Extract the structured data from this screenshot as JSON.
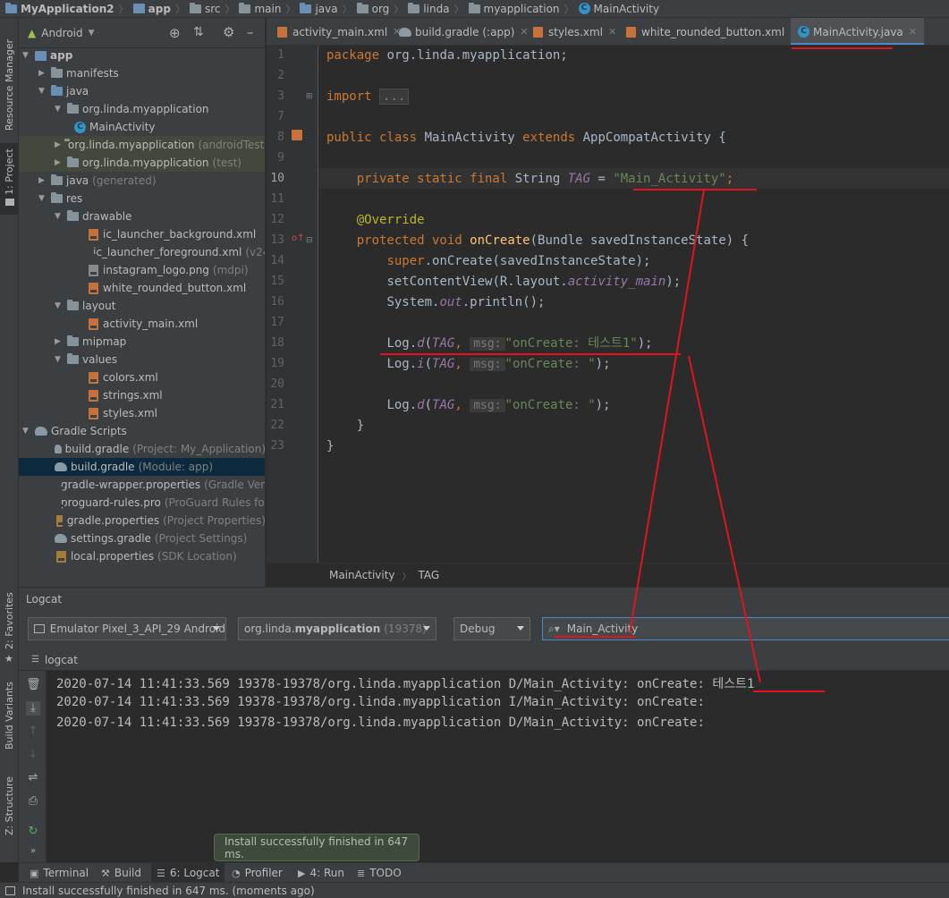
{
  "breadcrumb": [
    "MyApplication2",
    "app",
    "src",
    "main",
    "java",
    "org",
    "linda",
    "myapplication",
    "MainActivity"
  ],
  "left_strip": {
    "resource_manager": "Resource Manager",
    "project": "1: Project",
    "favorites": "2: Favorites",
    "build_variants": "Build Variants",
    "structure": "Z: Structure"
  },
  "project": {
    "view_selector": "Android",
    "tree": [
      {
        "label": "app",
        "hint": "",
        "type": "module"
      },
      {
        "label": "manifests",
        "hint": "",
        "type": "folder"
      },
      {
        "label": "java",
        "hint": "",
        "type": "folder"
      },
      {
        "label": "org.linda.myapplication",
        "hint": "",
        "type": "package"
      },
      {
        "label": "MainActivity",
        "hint": "",
        "type": "class"
      },
      {
        "label": "org.linda.myapplication",
        "hint": "(androidTest)",
        "type": "package"
      },
      {
        "label": "org.linda.myapplication",
        "hint": "(test)",
        "type": "package"
      },
      {
        "label": "java",
        "hint": "(generated)",
        "type": "folder"
      },
      {
        "label": "res",
        "hint": "",
        "type": "folder"
      },
      {
        "label": "drawable",
        "hint": "",
        "type": "folder"
      },
      {
        "label": "ic_launcher_background.xml",
        "hint": "",
        "type": "xml"
      },
      {
        "label": "ic_launcher_foreground.xml",
        "hint": "(v24)",
        "type": "xml"
      },
      {
        "label": "instagram_logo.png",
        "hint": "(mdpi)",
        "type": "img"
      },
      {
        "label": "white_rounded_button.xml",
        "hint": "",
        "type": "xml"
      },
      {
        "label": "layout",
        "hint": "",
        "type": "folder"
      },
      {
        "label": "activity_main.xml",
        "hint": "",
        "type": "xml"
      },
      {
        "label": "mipmap",
        "hint": "",
        "type": "folder"
      },
      {
        "label": "values",
        "hint": "",
        "type": "folder"
      },
      {
        "label": "colors.xml",
        "hint": "",
        "type": "xml"
      },
      {
        "label": "strings.xml",
        "hint": "",
        "type": "xml"
      },
      {
        "label": "styles.xml",
        "hint": "",
        "type": "xml"
      },
      {
        "label": "Gradle Scripts",
        "hint": "",
        "type": "gradle"
      },
      {
        "label": "build.gradle",
        "hint": "(Project: My_Application)",
        "type": "gradle"
      },
      {
        "label": "build.gradle",
        "hint": "(Module: app)",
        "type": "gradle"
      },
      {
        "label": "gradle-wrapper.properties",
        "hint": "(Gradle Version)",
        "type": "prop"
      },
      {
        "label": "proguard-rules.pro",
        "hint": "(ProGuard Rules for app)",
        "type": "prop"
      },
      {
        "label": "gradle.properties",
        "hint": "(Project Properties)",
        "type": "prop"
      },
      {
        "label": "settings.gradle",
        "hint": "(Project Settings)",
        "type": "gradle"
      },
      {
        "label": "local.properties",
        "hint": "(SDK Location)",
        "type": "prop"
      }
    ]
  },
  "editor_tabs": [
    "activity_main.xml",
    "build.gradle (:app)",
    "styles.xml",
    "white_rounded_button.xml",
    "MainActivity.java"
  ],
  "editor": {
    "line_numbers": [
      "1",
      "2",
      "3",
      "7",
      "8",
      "9",
      "10",
      "11",
      "12",
      "13",
      "14",
      "15",
      "16",
      "17",
      "18",
      "19",
      "20",
      "21",
      "22",
      "23"
    ],
    "code": {
      "package_kw": "package",
      "package_name": " org.linda.myapplication;",
      "import_kw": "import",
      "import_fold": "...",
      "class_line_kw1": "public class",
      "class_name": " MainActivity ",
      "class_line_kw2": "extends",
      "class_super": " AppCompatActivity {",
      "tag_kw": "private static final",
      "tag_type": " String ",
      "tag_name": "TAG",
      "tag_eq": " = ",
      "tag_value": "\"Main_Activity\"",
      "tag_end": ";",
      "override": "@Override",
      "oncreate_kw": "protected void",
      "oncreate_name": "onCreate",
      "oncreate_params": "(Bundle savedInstanceState) {",
      "super_kw": "super",
      "super_rest": ".onCreate(savedInstanceState);",
      "setcontent_a": "setContentView(R.layout.",
      "setcontent_b": "activity_main",
      "setcontent_c": ");",
      "println_a": "System.",
      "println_b": "out",
      "println_c": ".println();",
      "log1_a": "Log.",
      "log1_b": "d",
      "log1_hint": "msg:",
      "log1_str": "\"onCreate: 테스트1\"",
      "log2_b": "i",
      "log2_str": "\"onCreate: \"",
      "log3_b": "d",
      "log3_str": "\"onCreate: \"",
      "close_method": "}",
      "close_class": "}"
    },
    "breadcrumb": [
      "MainActivity",
      "TAG"
    ]
  },
  "logcat": {
    "title": "Logcat",
    "device": "Emulator Pixel_3_API_29 Android",
    "process_prefix": "org.linda.",
    "process_bold": "myapplication",
    "process_pid": "(19378)",
    "level": "Debug",
    "search_value": "Main_Activity",
    "tab": "logcat",
    "lines": [
      {
        "prefix": "2020-07-14 11:41:33.569 19378-19378/org.linda.myapplication D/Main_Activity: onCreate: ",
        "msg": "테스트1"
      },
      {
        "prefix": "2020-07-14 11:41:33.569 19378-19378/org.linda.myapplication I/Main_Activity: onCreate:",
        "msg": ""
      },
      {
        "prefix": "2020-07-14 11:41:33.569 19378-19378/org.linda.myapplication D/Main_Activity: onCreate:",
        "msg": ""
      }
    ]
  },
  "toast": "Install successfully finished in 647 ms.",
  "bottom_tools": [
    "Terminal",
    "Build",
    "6: Logcat",
    "Profiler",
    "4: Run",
    "TODO"
  ],
  "status": "Install successfully finished in 647 ms. (moments ago)",
  "colors": {
    "annotation": "#e0141e",
    "keyword": "#cc7832",
    "string": "#6a8759"
  }
}
